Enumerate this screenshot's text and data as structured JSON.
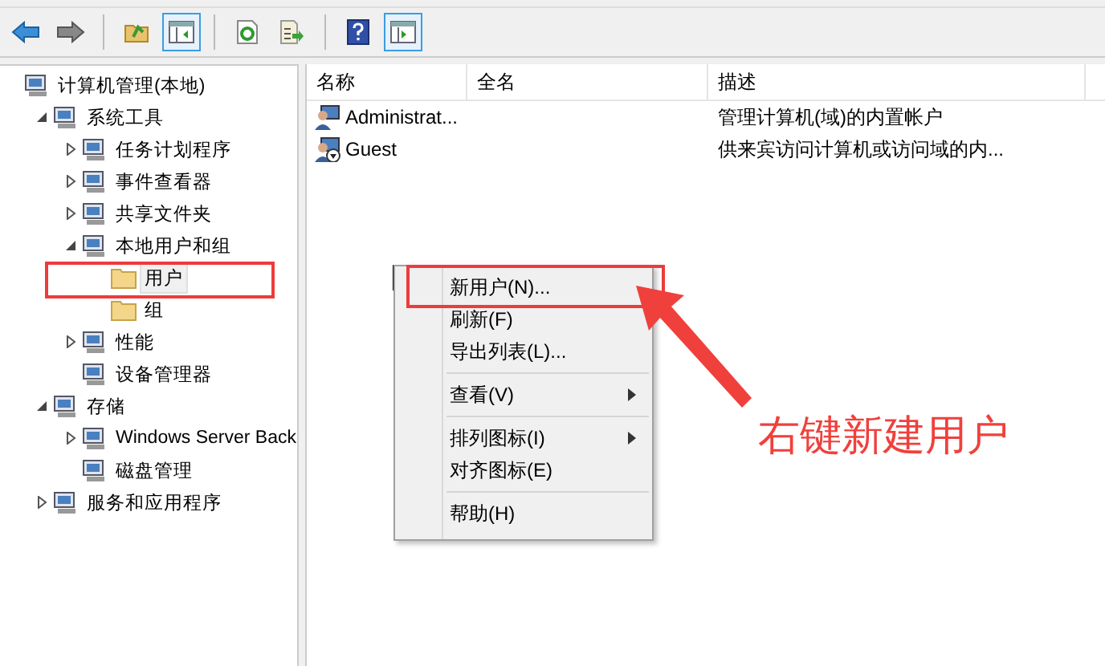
{
  "toolbar": [
    {
      "kind": "back",
      "pressed": false
    },
    {
      "kind": "forward",
      "pressed": false
    },
    {
      "kind": "up",
      "pressed": false
    },
    {
      "kind": "tree",
      "pressed": true
    },
    {
      "kind": "refresh",
      "pressed": false
    },
    {
      "kind": "export",
      "pressed": false
    },
    {
      "kind": "help",
      "pressed": false
    },
    {
      "kind": "pane",
      "pressed": true
    }
  ],
  "tree": [
    {
      "label": "计算机管理(本地)",
      "kind": "tool",
      "selected": false,
      "children": [
        {
          "label": "系统工具",
          "kind": "tool",
          "expanded": true,
          "selected": false,
          "children": [
            {
              "label": "任务计划程序",
              "kind": "tool",
              "expanded": false,
              "selected": false
            },
            {
              "label": "事件查看器",
              "kind": "tool",
              "expanded": false,
              "selected": false
            },
            {
              "label": "共享文件夹",
              "kind": "tool",
              "expanded": false,
              "selected": false
            },
            {
              "label": "本地用户和组",
              "kind": "tool",
              "expanded": true,
              "selected": false,
              "children": [
                {
                  "label": "用户",
                  "kind": "folder",
                  "selected": true
                },
                {
                  "label": "组",
                  "kind": "folder",
                  "selected": false
                }
              ]
            },
            {
              "label": "性能",
              "kind": "tool",
              "expanded": false,
              "selected": false
            },
            {
              "label": "设备管理器",
              "kind": "tool",
              "selected": false
            }
          ]
        },
        {
          "label": "存储",
          "kind": "tool",
          "expanded": true,
          "selected": false,
          "children": [
            {
              "label": "Windows Server Back",
              "kind": "tool",
              "expanded": false,
              "selected": false
            },
            {
              "label": "磁盘管理",
              "kind": "tool",
              "selected": false
            }
          ]
        },
        {
          "label": "服务和应用程序",
          "kind": "tool",
          "expanded": false,
          "selected": false
        }
      ]
    }
  ],
  "list": {
    "columns": [
      "名称",
      "全名",
      "描述"
    ],
    "rows": [
      {
        "name": "Administrat...",
        "description": "管理计算机(域)的内置帐户",
        "disabled": false
      },
      {
        "name": "Guest",
        "description": "供来宾访问计算机或访问域的内...",
        "disabled": true
      }
    ]
  },
  "context_menu": [
    {
      "kind": "item",
      "label": "新用户(N)...",
      "submenu": false
    },
    {
      "kind": "item",
      "label": "刷新(F)",
      "submenu": false
    },
    {
      "kind": "item",
      "label": "导出列表(L)...",
      "submenu": false
    },
    {
      "kind": "separator"
    },
    {
      "kind": "item",
      "label": "查看(V)",
      "submenu": true
    },
    {
      "kind": "separator"
    },
    {
      "kind": "item",
      "label": "排列图标(I)",
      "submenu": true
    },
    {
      "kind": "item",
      "label": "对齐图标(E)",
      "submenu": false
    },
    {
      "kind": "separator"
    },
    {
      "kind": "item",
      "label": "帮助(H)",
      "submenu": false
    }
  ],
  "annotation": {
    "text": "右键新建用户"
  }
}
